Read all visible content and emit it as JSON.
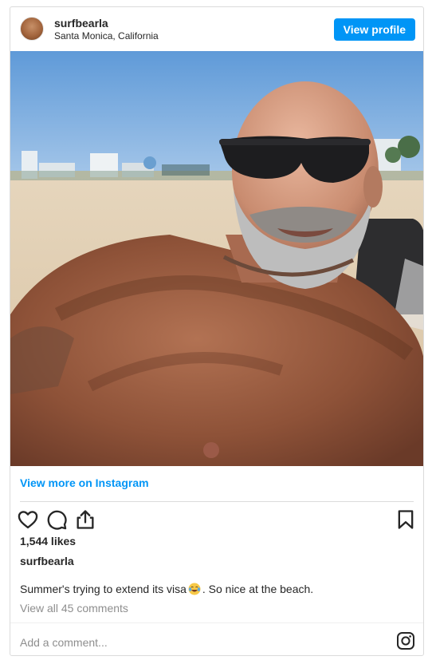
{
  "header": {
    "username": "surfbearla",
    "location": "Santa Monica, California",
    "view_profile_label": "View profile"
  },
  "post": {
    "image_icon": "photo-image",
    "view_more_label": "View more on Instagram",
    "likes": "1,544 likes",
    "caption_user": "surfbearla",
    "caption_before": "Summer's trying to extend its visa",
    "caption_emoji": "laughing-crying-emoji",
    "caption_after": ". So nice at the beach.",
    "view_comments_label": "View all 45 comments",
    "add_comment_placeholder": "Add a comment..."
  },
  "icons": {
    "like": "heart-icon",
    "comment": "comment-bubble-icon",
    "share": "share-icon",
    "save": "bookmark-icon",
    "instagram": "instagram-logo-icon"
  },
  "colors": {
    "accent": "#0095f6",
    "text": "#262626",
    "muted": "#8e8e8e",
    "border": "#dbdbdb"
  }
}
